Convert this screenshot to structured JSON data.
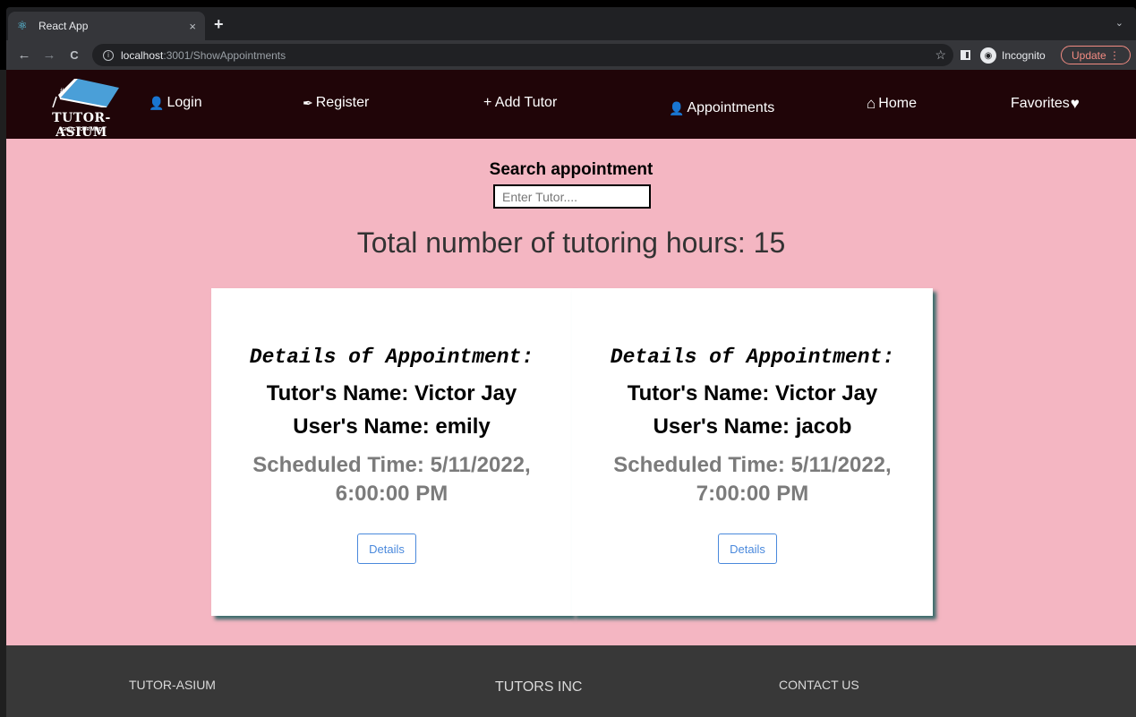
{
  "browser": {
    "tab_title": "React App",
    "tab_close": "×",
    "new_tab": "+",
    "tab_search": "⌄",
    "nav_back": "←",
    "nav_forward": "→",
    "nav_reload": "C",
    "url_host": "localhost",
    "url_path": ":3001/ShowAppointments",
    "bookmark": "☆",
    "incognito_label": "Incognito",
    "update_label": "Update ⋮"
  },
  "navbar": {
    "logo_text": "TUTOR-ASIUM",
    "logo_tagline": "IGNITE YOUR MIND",
    "items": [
      {
        "icon": "👤",
        "label": "Login"
      },
      {
        "icon": "✒",
        "label": "Register"
      },
      {
        "icon": "",
        "label": "+ Add Tutor"
      },
      {
        "icon": "👤",
        "label": "Appointments"
      },
      {
        "icon": "⌂",
        "label": "Home"
      },
      {
        "icon": "♥",
        "label": "Favorites"
      }
    ]
  },
  "search": {
    "title": "Search appointment",
    "placeholder": "Enter Tutor...."
  },
  "summary": {
    "total_hours": "Total number of tutoring hours: 15"
  },
  "appointments": [
    {
      "heading": "Details of Appointment:",
      "tutor": "Tutor's Name: Victor Jay",
      "user": "User's Name: emily",
      "time": "Scheduled Time: 5/11/2022, 6:00:00 PM",
      "button": "Details"
    },
    {
      "heading": "Details of Appointment:",
      "tutor": "Tutor's Name: Victor Jay",
      "user": "User's Name: jacob",
      "time": "Scheduled Time: 5/11/2022, 7:00:00 PM",
      "button": "Details"
    }
  ],
  "footer": {
    "col1": "TUTOR-ASIUM",
    "col2": "TUTORS INC",
    "col3": "CONTACT US"
  },
  "colors": {
    "navbar_bg": "#200508",
    "main_bg": "#f4b6c2",
    "footer_bg": "#383838",
    "button_accent": "#4a89dc",
    "card_shadow": "#3a6b6b"
  }
}
